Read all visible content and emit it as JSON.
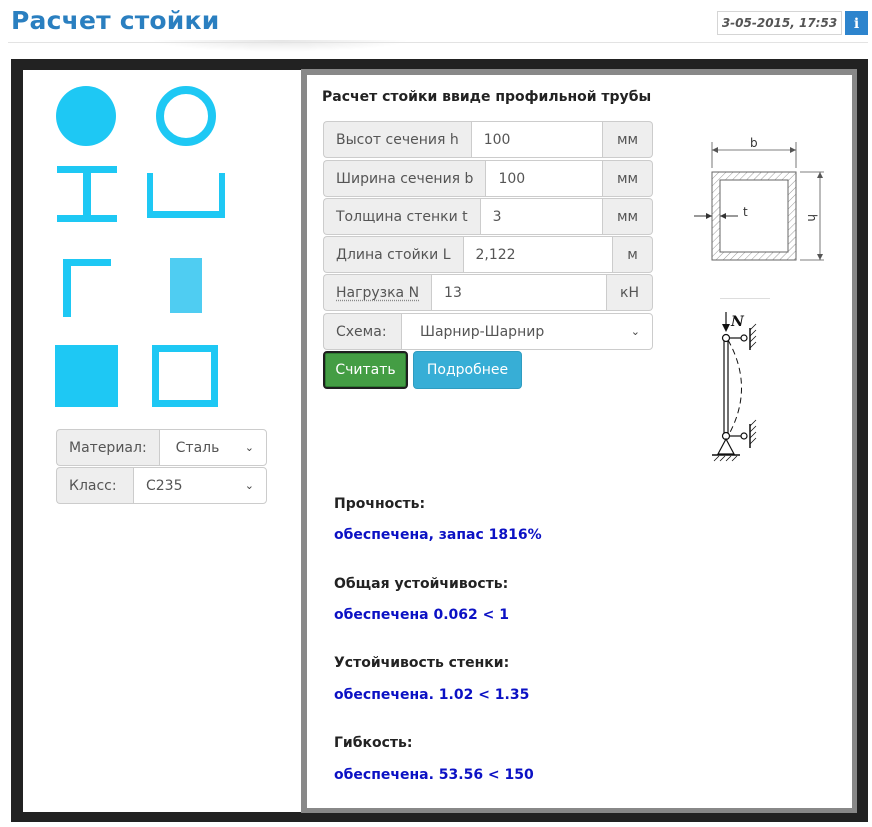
{
  "header": {
    "title": "Расчет стойки",
    "timestamp": "3-05-2015, 17:53",
    "info_label": "i"
  },
  "sections": {
    "shapes": [
      "circle-solid",
      "circle-tube",
      "i-beam",
      "channel",
      "angle",
      "rectangle-bar",
      "square-bar",
      "square-tube"
    ],
    "shape_color": "#1ec8f4"
  },
  "material": {
    "material_label": "Материал:",
    "material_value": "Сталь",
    "class_label": "Класс:",
    "class_value": "С235"
  },
  "form": {
    "title": "Расчет стойки ввиде профильной трубы",
    "height_label": "Высот сечения h",
    "height_value": "100",
    "height_unit": "мм",
    "width_label": "Ширина сечения b",
    "width_value": "100",
    "width_unit": "мм",
    "wall_label": "Толщина стенки t",
    "wall_value": "3",
    "wall_unit": "мм",
    "length_label": "Длина стойки L",
    "length_value": "2,122",
    "length_unit": "м",
    "load_label": "Нагрузка N",
    "load_value": "13",
    "load_unit": "кН",
    "scheme_label": "Схема:",
    "scheme_value": "Шарнир-Шарнир",
    "calc_button": "Считать",
    "more_button": "Подробнее"
  },
  "diagram": {
    "section_b": "b",
    "section_t": "t",
    "section_h": "h",
    "load_symbol": "N"
  },
  "results": [
    {
      "label": "Прочность:",
      "value": "обеспечена, запас 1816%"
    },
    {
      "label": "Общая устойчивость:",
      "value": "обеспечена 0.062 < 1"
    },
    {
      "label": "Устойчивость стенки:",
      "value": "обеспечена. 1.02 < 1.35"
    },
    {
      "label": "Гибкость:",
      "value": "обеспечена. 53.56 < 150"
    }
  ],
  "colors": {
    "title": "#2a7fc0",
    "calc_button": "#449d44",
    "more_button": "#37aed6",
    "result_value": "#0b11c4"
  }
}
